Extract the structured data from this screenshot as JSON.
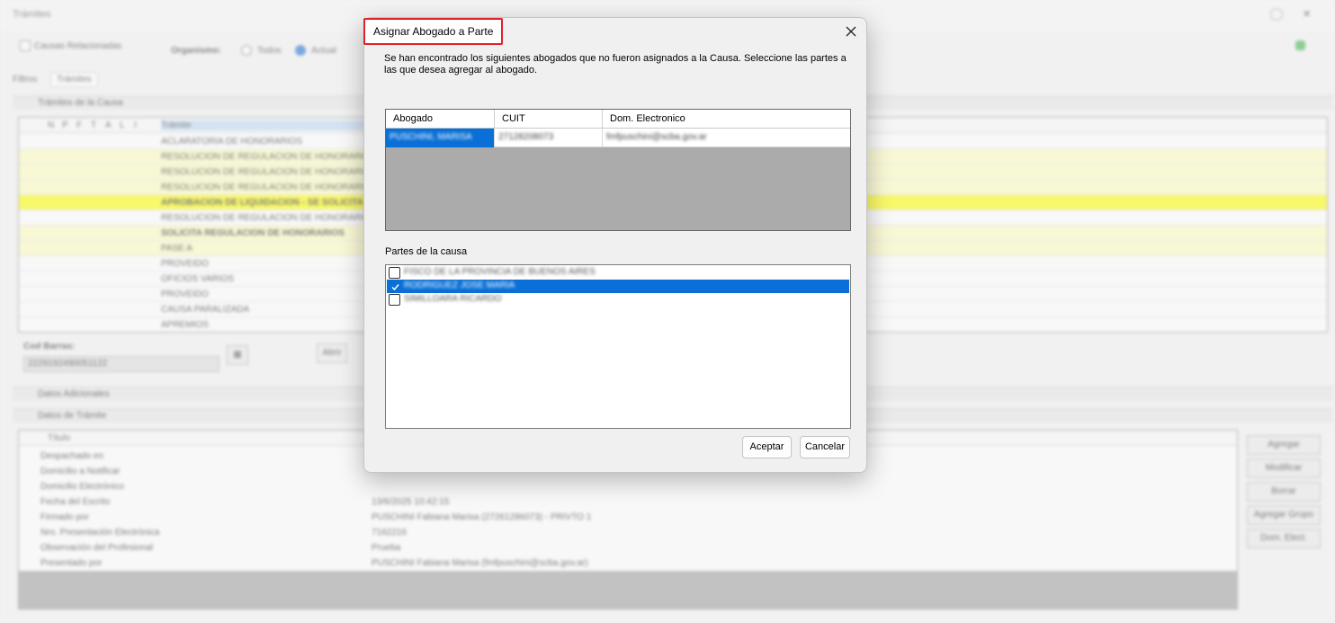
{
  "background": {
    "title": "Trámites",
    "causas_relacionadas": "Causas Relacionadas",
    "organismo_label": "Organismo:",
    "organismo_options": [
      "Todos",
      "Actual"
    ],
    "tabs": [
      "Filtros",
      "Trámites"
    ],
    "section_tramites": "Trámites de la Causa",
    "grid_headers": [
      "N",
      "P",
      "F",
      "T",
      "A",
      "L",
      "I",
      "Trámite"
    ],
    "rows": [
      "ACLARATORIA DE HONORARIOS",
      "RESOLUCION DE REGULACION DE HONORARIOS",
      "RESOLUCION DE REGULACION DE HONORARIOS",
      "RESOLUCION DE REGULACION DE HONORARIOS",
      "APROBACION DE LIQUIDACION - SE SOLICITA",
      "RESOLUCION DE REGULACION DE HONORARIOS",
      "SOLICITA REGULACION DE HONORARIOS",
      "PASE A",
      "PROVEIDO",
      "OFICIOS VARIOS",
      "PROVEIDO",
      "CAUSA PARALIZADA",
      "APREMIOS"
    ],
    "cod_barras_label": "Cod Barras:",
    "cod_barras_value": "2229192490051122",
    "btn_abrir": "Abrir",
    "section_adicionales": "Datos Adicionales",
    "section_datos": "Datos de Trámite",
    "props_header": "Título",
    "props": [
      {
        "k": "Despachado en",
        "v": ""
      },
      {
        "k": "Domicilio a Notificar",
        "v": ""
      },
      {
        "k": "Domicilio Electrónico",
        "v": ""
      },
      {
        "k": "Fecha del Escrito",
        "v": "13/6/2025 10:42:15"
      },
      {
        "k": "Firmado por",
        "v": "PUSCHINI Fabiana Marisa (27261286073) - PRIVTO 1"
      },
      {
        "k": "Nro. Presentación Electrónica",
        "v": "7162216"
      },
      {
        "k": "Observación del Profesional",
        "v": "Prueba"
      },
      {
        "k": "Presentado por",
        "v": "PUSCHINI Fabiana Marisa (fmfpuschini@scba.gov.ar)"
      }
    ],
    "side_buttons": [
      "Agregar",
      "Modificar",
      "Borrar",
      "Agregar Grupo",
      "Dom. Elect."
    ]
  },
  "dialog": {
    "title": "Asignar Abogado a Parte",
    "message": "Se han encontrado los siguientes abogados que no fueron asignados a la Causa. Seleccione las partes a las que desea agregar al abogado.",
    "columns": [
      "Abogado",
      "CUIT",
      "Dom. Electronico"
    ],
    "lawyer_row": {
      "abogado": "PUSCHINI, MARISA",
      "cuit": "27128208073",
      "dom": "fmfpuschini@scba.gov.ar"
    },
    "partes_label": "Partes de la causa",
    "partes": [
      {
        "label": "FISCO DE LA PROVINCIA DE BUENOS AIRES",
        "checked": false,
        "selected": false
      },
      {
        "label": "RODRIGUEZ JOSE MARIA",
        "checked": true,
        "selected": true
      },
      {
        "label": "SIMILLOARA RICARDO",
        "checked": false,
        "selected": false
      }
    ],
    "accept_label": "Aceptar",
    "cancel_label": "Cancelar"
  }
}
